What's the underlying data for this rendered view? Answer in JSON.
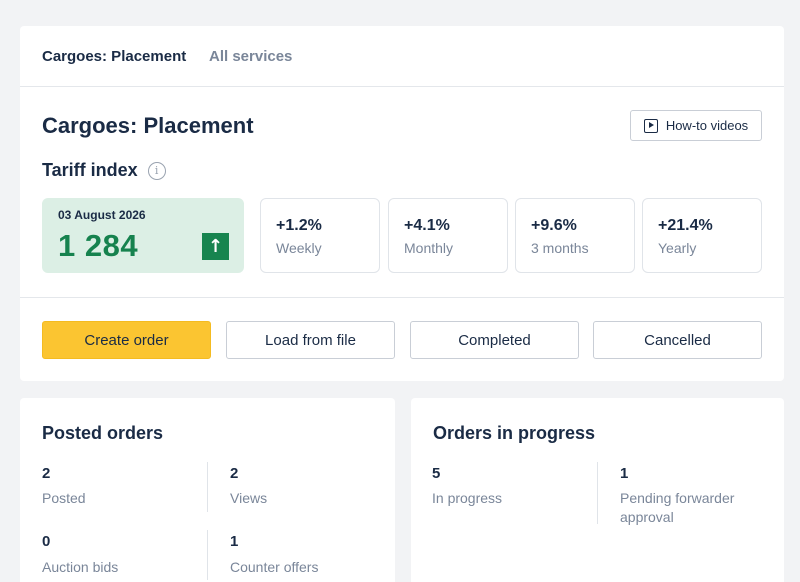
{
  "tabs": [
    {
      "label": "Cargoes: Placement",
      "active": true
    },
    {
      "label": "All services",
      "active": false
    }
  ],
  "page_title": "Cargoes: Placement",
  "howto_label": "How-to videos",
  "tariff": {
    "title": "Tariff index",
    "date": "03 August 2026",
    "value": "1 284",
    "trend": "up",
    "stats": [
      {
        "pct": "+1.2%",
        "label": "Weekly"
      },
      {
        "pct": "+4.1%",
        "label": "Monthly"
      },
      {
        "pct": "+9.6%",
        "label": "3 months"
      },
      {
        "pct": "+21.4%",
        "label": "Yearly"
      }
    ]
  },
  "actions": {
    "create": "Create order",
    "load": "Load from file",
    "completed": "Completed",
    "cancelled": "Cancelled"
  },
  "posted_orders": {
    "title": "Posted orders",
    "metrics": [
      {
        "value": "2",
        "label": "Posted"
      },
      {
        "value": "2",
        "label": "Views"
      },
      {
        "value": "0",
        "label": "Auction bids"
      },
      {
        "value": "1",
        "label": "Counter offers"
      }
    ]
  },
  "orders_in_progress": {
    "title": "Orders in progress",
    "metrics": [
      {
        "value": "5",
        "label": "In progress"
      },
      {
        "value": "1",
        "label": "Pending forwarder approval"
      }
    ]
  },
  "colors": {
    "accent_yellow": "#fbc531",
    "index_green": "#16824e",
    "index_bg": "#dcefe5"
  }
}
